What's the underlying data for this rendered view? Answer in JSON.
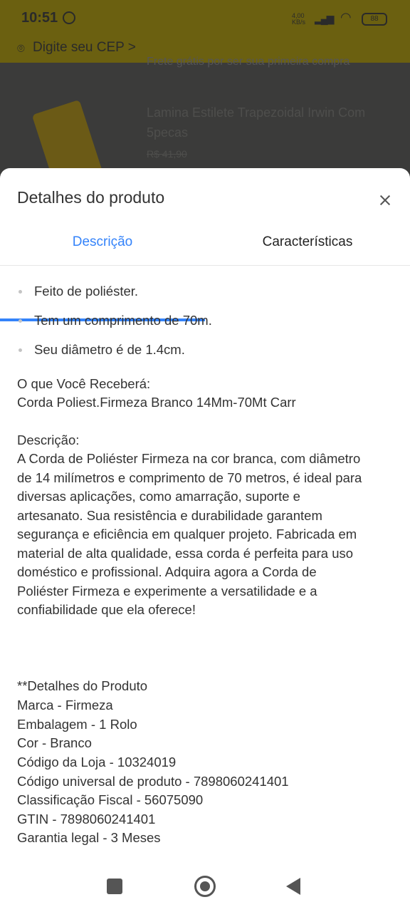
{
  "background": {
    "status_bar": {
      "time": "10:51",
      "network": "4,00 KB/s",
      "battery": "88"
    },
    "cep_label": "Digite seu CEP >",
    "promo_text": "Frete grátis por ser sua primeira compra",
    "product_title": "Lamina Estilete Trapezoidal Irwin Com 5pecas",
    "product_old_price": "R$ 41,90"
  },
  "sheet": {
    "title": "Detalhes do produto",
    "tabs": [
      {
        "label": "Descrição",
        "active": true
      },
      {
        "label": "Características",
        "active": false
      }
    ],
    "bullets": [
      "Feito de poliéster.",
      "Tem um comprimento de 70m.",
      "Seu diâmetro é de 1.4cm."
    ],
    "receive_heading": "O que Você Receberá:",
    "receive_item": "Corda Poliest.Firmeza Branco 14Mm-70Mt Carr",
    "description_heading": "Descrição:",
    "description_lines": [
      "A Corda de Poliéster Firmeza na cor branca, com diâmetro",
      "de 14 milímetros e comprimento de 70 metros, é ideal para",
      "diversas aplicações, como amarração, suporte e",
      "artesanato. Sua resistência e durabilidade garantem",
      "segurança e eficiência em qualquer projeto. Fabricada em",
      "material de alta qualidade, essa corda é perfeita para uso",
      "doméstico e profissional. Adquira agora a Corda de",
      "Poliéster Firmeza e experimente a versatilidade e a",
      "confiabilidade que ela oferece!"
    ],
    "details": [
      "**Detalhes do Produto",
      "Marca - Firmeza",
      "Embalagem - 1 Rolo",
      "Cor - Branco",
      "Código da Loja - 10324019",
      "Código universal de produto - 7898060241401",
      "Classificação Fiscal - 56075090",
      "GTIN - 7898060241401",
      "Garantia legal - 3 Meses"
    ]
  },
  "colors": {
    "accent": "#3483fa",
    "text": "#333333",
    "background_dim": "#3a3a38"
  },
  "icons": {
    "close": "close-icon",
    "recents": "recents-icon",
    "home": "home-icon",
    "back": "back-icon"
  }
}
